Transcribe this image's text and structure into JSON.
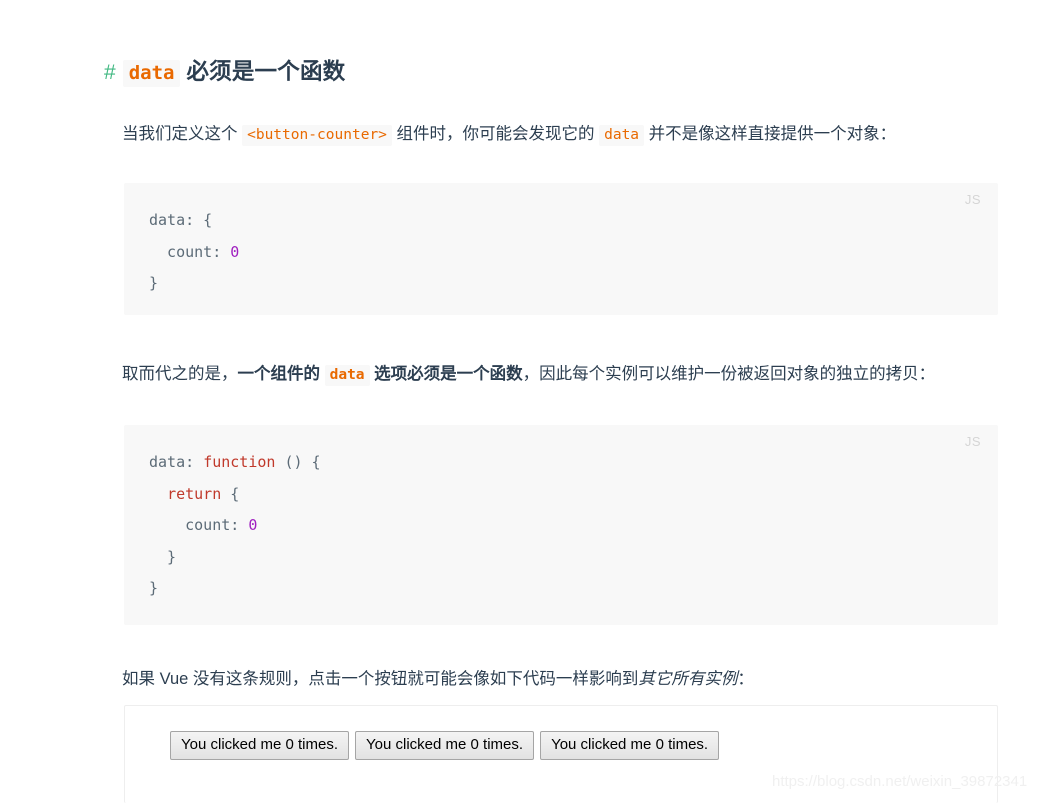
{
  "heading": {
    "anchor": "#",
    "code": "data",
    "text": "必须是一个函数"
  },
  "paragraphs": {
    "p1_a": "当我们定义这个 ",
    "p1_code1": "<button-counter>",
    "p1_b": " 组件时，你可能会发现它的 ",
    "p1_code2": "data",
    "p1_c": " 并不是像这样直接提供一个对象：",
    "p2_a": "取而代之的是，",
    "p2_bold1": "一个组件的 ",
    "p2_code": "data",
    "p2_bold2": " 选项必须是一个函数",
    "p2_b": "，因此每个实例可以维护一份被返回对象的独立的拷贝：",
    "p3_a": "如果 Vue 没有这条规则，点击一个按钮就可能会像如下代码一样影响到",
    "p3_italic": "其它所有实例",
    "p3_b": "："
  },
  "codeblocks": [
    {
      "lang_label": "JS",
      "lines": [
        {
          "plain": "data: {"
        },
        {
          "plain": "  count: ",
          "num": "0"
        },
        {
          "plain": "}"
        }
      ]
    },
    {
      "lang_label": "JS",
      "lines": [
        {
          "plain": "data: ",
          "kw": "function",
          "tail": " () {"
        },
        {
          "plain": "  ",
          "kw": "return",
          "tail": " {"
        },
        {
          "plain": "    count: ",
          "num": "0"
        },
        {
          "plain": "  }"
        },
        {
          "plain": "}"
        }
      ]
    }
  ],
  "demo": {
    "buttons": [
      "You clicked me 0 times.",
      "You clicked me 0 times.",
      "You clicked me 0 times."
    ]
  },
  "watermark": "https://blog.csdn.net/weixin_39872341",
  "colors": {
    "anchor_green": "#42b983",
    "inline_code_orange": "#e96900",
    "keyword_red": "#c0392b",
    "number_purple": "#a020c0",
    "body_text": "#2c3e50",
    "code_bg": "#f8f8f8"
  }
}
